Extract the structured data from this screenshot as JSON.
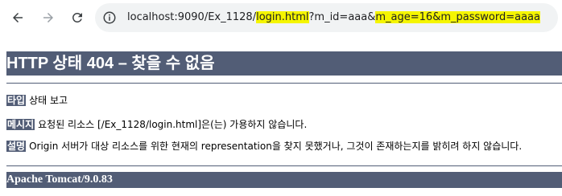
{
  "browser": {
    "url_host": "localhost:9090/Ex_1128/",
    "url_path": "login.html",
    "url_q1_pre": "?m_id=aaa&",
    "url_q2": "m_age=16",
    "url_q3": "&m_password=aaaa"
  },
  "error": {
    "title": "HTTP 상태 404 – 찾을 수 없음",
    "type_label": "타입",
    "type_value": "상태 보고",
    "message_label": "메시지",
    "message_value": "요청된 리소스 [/Ex_1128/login.html]은(는) 가용하지 않습니다.",
    "description_label": "설명",
    "description_value": "Origin 서버가 대상 리소스를 위한 현재의 representation을 찾지 못했거나, 그것이 존재하는지를 밝히려 하지 않습니다.",
    "footer": "Apache Tomcat/9.0.83"
  },
  "colors": {
    "banner": "#525d76",
    "highlight": "#f5f500",
    "address_bg": "#f1f3f4"
  }
}
